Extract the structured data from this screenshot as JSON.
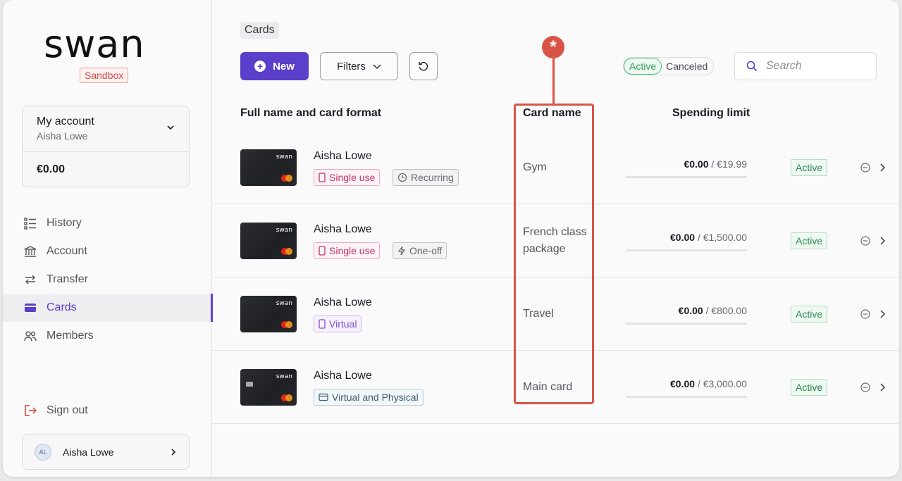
{
  "brand": {
    "logo": "swan",
    "env_badge": "Sandbox"
  },
  "account": {
    "title": "My account",
    "holder": "Aisha Lowe",
    "balance": "€0.00"
  },
  "nav": [
    {
      "label": "History",
      "icon": "list-icon"
    },
    {
      "label": "Account",
      "icon": "bank-icon"
    },
    {
      "label": "Transfer",
      "icon": "arrows-icon"
    },
    {
      "label": "Cards",
      "icon": "card-icon",
      "active": true
    },
    {
      "label": "Members",
      "icon": "members-icon"
    }
  ],
  "signout": "Sign out",
  "user": {
    "initials": "AL",
    "name": "Aisha Lowe"
  },
  "breadcrumb": "Cards",
  "toolbar": {
    "new_label": "New",
    "filters_label": "Filters",
    "status_toggle": {
      "active": "Active",
      "canceled": "Canceled"
    },
    "search_placeholder": "Search"
  },
  "table": {
    "headers": {
      "name": "Full name and card format",
      "card_name": "Card name",
      "limit": "Spending limit"
    },
    "rows": [
      {
        "holder": "Aisha Lowe",
        "tags": [
          {
            "label": "Single use",
            "style": "pink",
            "icon": "phone-icon"
          },
          {
            "label": "Recurring",
            "style": "gray",
            "icon": "clock-icon"
          }
        ],
        "card_name": "Gym",
        "spent": "€0.00",
        "limit": "/ €19.99",
        "status": "Active"
      },
      {
        "holder": "Aisha Lowe",
        "tags": [
          {
            "label": "Single use",
            "style": "pink",
            "icon": "phone-icon"
          },
          {
            "label": "One-off",
            "style": "gray",
            "icon": "bolt-icon"
          }
        ],
        "card_name": "French class package",
        "spent": "€0.00",
        "limit": "/ €1,500.00",
        "status": "Active"
      },
      {
        "holder": "Aisha Lowe",
        "tags": [
          {
            "label": "Virtual",
            "style": "purple",
            "icon": "phone-icon"
          }
        ],
        "card_name": "Travel",
        "spent": "€0.00",
        "limit": "/ €800.00",
        "status": "Active"
      },
      {
        "holder": "Aisha Lowe",
        "tags": [
          {
            "label": "Virtual and Physical",
            "style": "teal",
            "icon": "card-icon"
          }
        ],
        "card_name": "Main card",
        "spent": "€0.00",
        "limit": "/ €3,000.00",
        "status": "Active"
      }
    ]
  },
  "colors": {
    "accent": "#5b3ec9",
    "annotation": "#d95447",
    "active_green": "#2f9e5c"
  }
}
